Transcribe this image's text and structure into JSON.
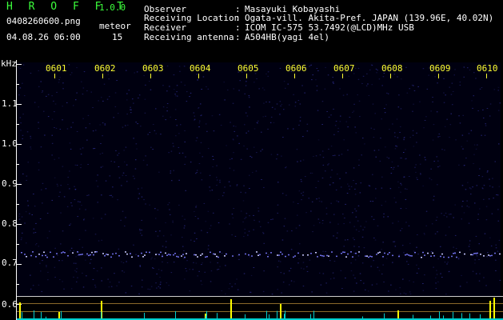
{
  "header": {
    "app_title": "H R O F F T",
    "app_version": "1.0.0",
    "filename": "0408260600.png",
    "datetime": "04.08.26 06:00",
    "meteor_label": "meteor",
    "meteor_count": "15"
  },
  "info": [
    {
      "label": "Observer",
      "sep": ":",
      "value": "Masayuki Kobayashi"
    },
    {
      "label": "Receiving Location",
      "sep": ":",
      "value": "Ogata-vill. Akita-Pref. JAPAN (139.96E, 40.02N)"
    },
    {
      "label": "Receiver",
      "sep": ":",
      "value": "ICOM IC-575 53.7492(@LCD)MHz USB"
    },
    {
      "label": "Receiving antenna",
      "sep": ":",
      "value": "A504HB(yagi 4el)"
    }
  ],
  "spectrogram": {
    "y_unit": "kHz",
    "y_ticks": [
      "1.1",
      "1.0",
      "0.9",
      "0.8",
      "0.7",
      "0.6"
    ],
    "minute_labels": [
      "0601",
      "0602",
      "0603",
      "0604",
      "0605",
      "0606",
      "0607",
      "0608",
      "0609",
      "0610"
    ],
    "colors": {
      "background": "#000010",
      "noise": "#2a2a8a",
      "echo": "#9a9aff",
      "axis": "#ffffff",
      "minute_label": "#ffff33",
      "meteor_bar": "#ffff00",
      "baseline": "#00d0d0"
    }
  }
}
